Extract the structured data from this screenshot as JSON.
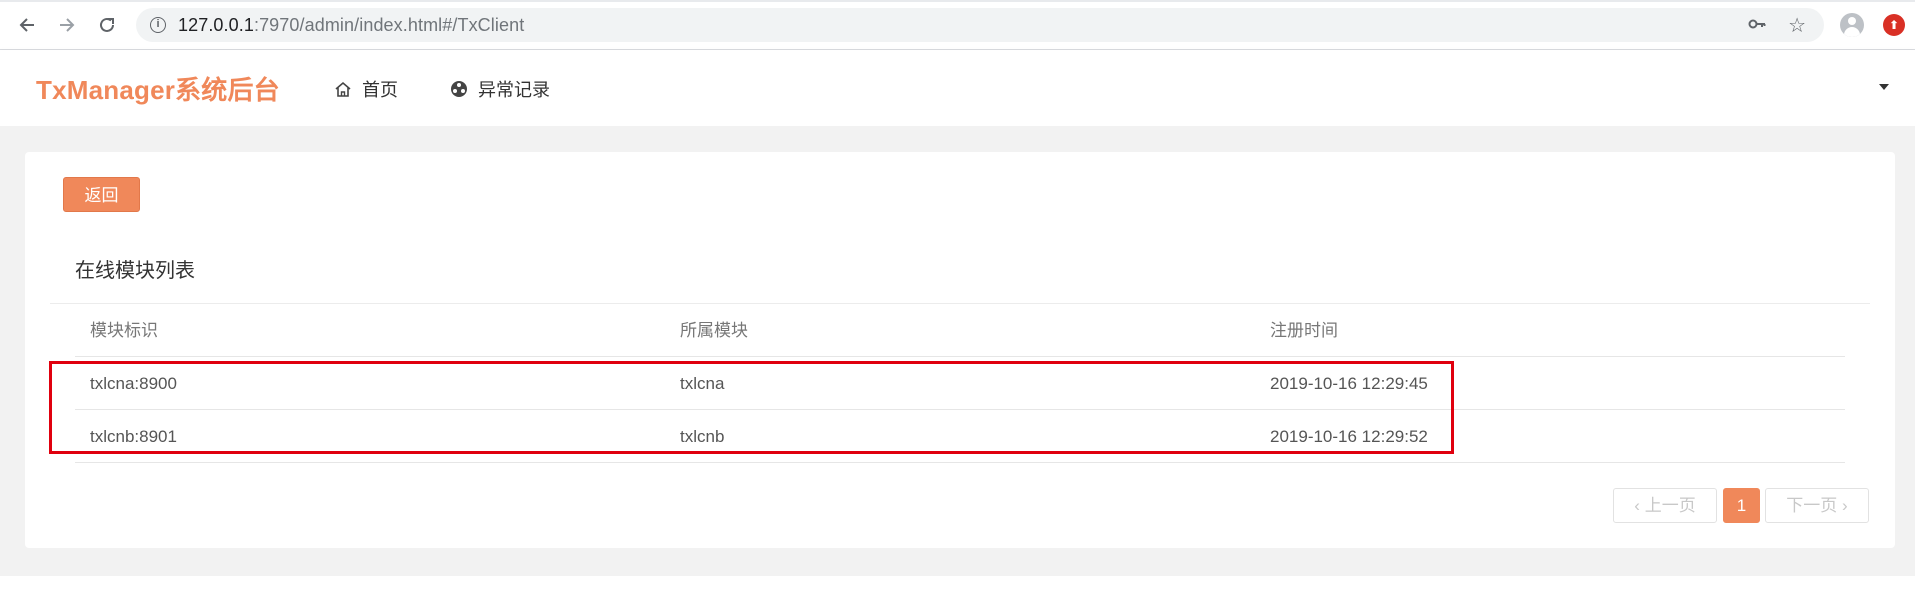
{
  "browser": {
    "url_host": "127.0.0.1",
    "url_rest": ":7970/admin/index.html#/TxClient",
    "icons": [
      "back-icon",
      "forward-icon",
      "reload-icon",
      "info-icon",
      "key-icon",
      "star-icon",
      "profile-icon",
      "extension-icon"
    ]
  },
  "header": {
    "logo": "TxManager系统后台",
    "menu": [
      {
        "label": "首页",
        "icon": "home-icon"
      },
      {
        "label": "异常记录",
        "icon": "exception-icon"
      }
    ]
  },
  "toolbar": {
    "back_label": "返回"
  },
  "card": {
    "title": "在线模块列表"
  },
  "table": {
    "columns": [
      "模块标识",
      "所属模块",
      "注册时间"
    ],
    "rows": [
      [
        "txlcna:8900",
        "txlcna",
        "2019-10-16 12:29:45"
      ],
      [
        "txlcnb:8901",
        "txlcnb",
        "2019-10-16 12:29:52"
      ]
    ]
  },
  "pagination": {
    "prev_label": "上一页",
    "current_page": "1",
    "next_label": "下一页"
  },
  "colors": {
    "accent": "#f0885a",
    "highlight": "#e0000e"
  }
}
